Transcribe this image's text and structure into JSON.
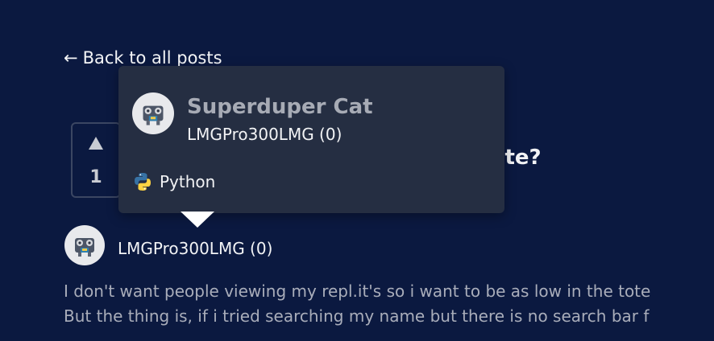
{
  "nav": {
    "back_label": "Back to all posts"
  },
  "post": {
    "vote_count": "1",
    "title_fragment": "vate?",
    "author": "LMGPro300LMG (0)",
    "body_lines": [
      "I don't want people viewing my repl.it's so i want to be as low in the tote",
      "But the thing is, if i tried searching my name but there is no search bar f"
    ]
  },
  "tooltip": {
    "full_name": "Superduper Cat",
    "username": "LMGPro300LMG (0)",
    "language": "Python"
  },
  "colors": {
    "background": "#0b1940",
    "card": "#252e42",
    "python_blue": "#3772a4",
    "python_yellow": "#ffd343"
  },
  "icons": {
    "back": "arrow-left-icon",
    "upvote": "upvote-arrow-icon",
    "language": "python-icon"
  }
}
